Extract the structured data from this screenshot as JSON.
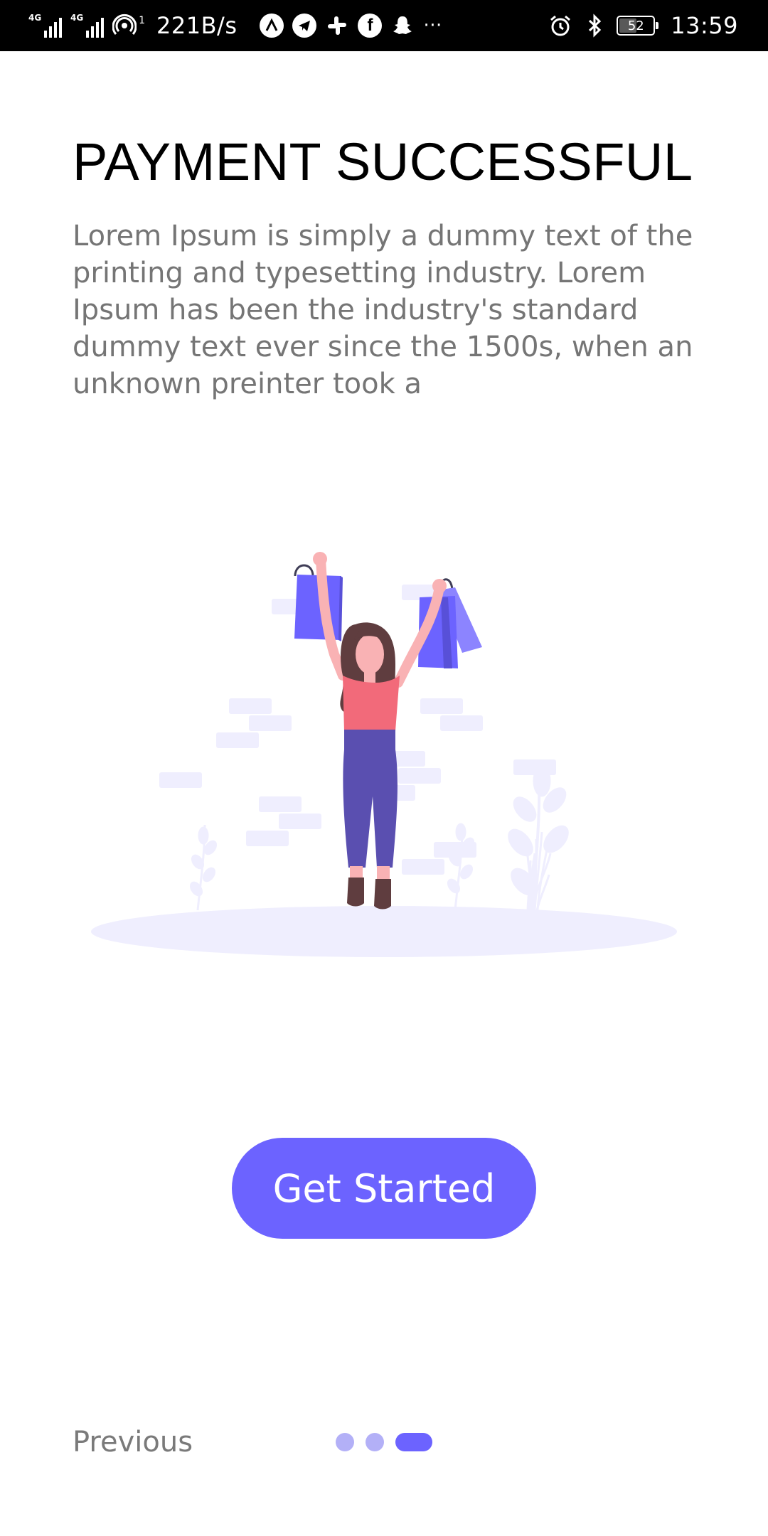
{
  "status_bar": {
    "signal_1_tag": "4G",
    "signal_2_tag": "4G",
    "hotspot_badge": "1",
    "speed": "221B/s",
    "notification_icons": [
      "app-a-icon",
      "telegram-icon",
      "slack-icon",
      "facebook-icon",
      "snapchat-icon"
    ],
    "more": "···",
    "battery_level": "52",
    "time": "13:59"
  },
  "content": {
    "title": "PAYMENT SUCCESSFUL",
    "description": "Lorem Ipsum is simply a dummy text of the printing and typesetting industry. Lorem Ipsum has been the industry's standard dummy text ever since the 1500s, when an unknown preinter took a"
  },
  "actions": {
    "get_started_label": "Get Started",
    "previous_label": "Previous"
  },
  "pager": {
    "total": 3,
    "active_index": 2
  },
  "colors": {
    "accent": "#6c63ff",
    "dot_inactive": "#b3b0f7",
    "body_text": "#757575",
    "status_bar_bg": "#000000"
  }
}
